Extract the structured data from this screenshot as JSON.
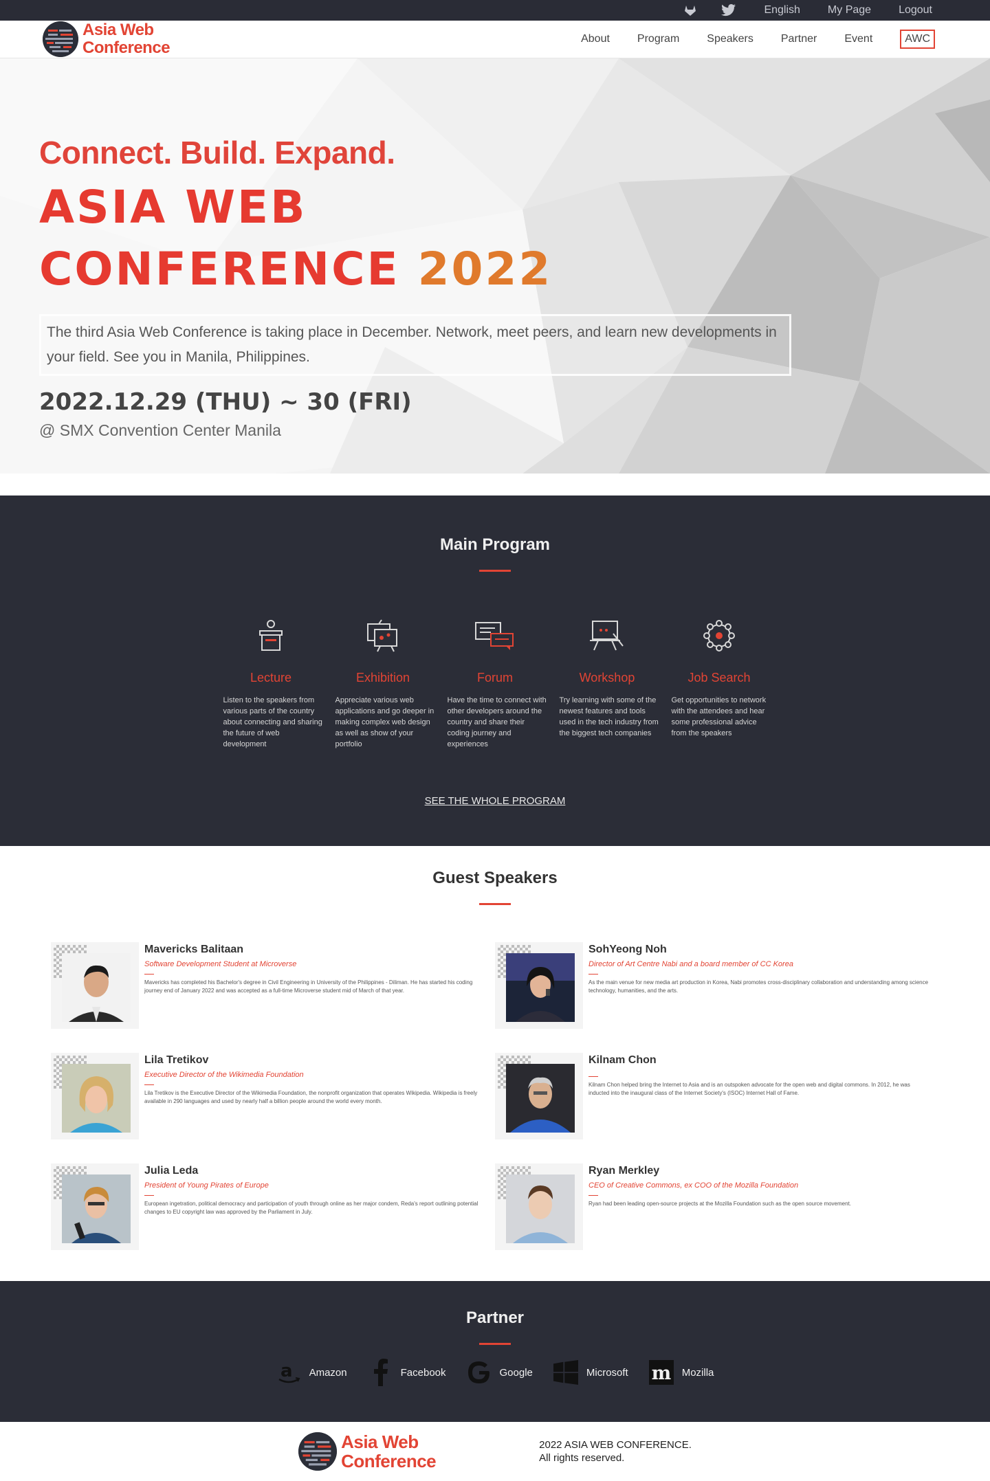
{
  "topbar": {
    "icons": [
      "gitlab-icon",
      "twitter-icon"
    ],
    "links": [
      "English",
      "My Page",
      "Logout"
    ]
  },
  "brand": {
    "line1": "Asia Web",
    "line2": "Conference",
    "color": "#e24434"
  },
  "nav": {
    "items": [
      "About",
      "Program",
      "Speakers",
      "Partner",
      "Event"
    ],
    "active": "AWC"
  },
  "hero": {
    "tagline": "Connect. Build. Expand.",
    "title_line1": "ASIA WEB",
    "title_line2": "CONFERENCE",
    "title_year": "2022",
    "description": "The third Asia Web Conference is taking place in December. Network, meet peers, and learn new developments in your field. See you in Manila, Philippines.",
    "date": "2022.12.29 (THU) ~ 30 (FRI)",
    "venue": "@ SMX Convention Center Manila"
  },
  "program": {
    "title": "Main Program",
    "items": [
      {
        "icon": "podium-icon",
        "title": "Lecture",
        "desc": "Listen to the speakers from various parts of the country about connecting and sharing the future of web development"
      },
      {
        "icon": "exhibition-icon",
        "title": "Exhibition",
        "desc": "Appreciate various web applications and go deeper in making complex web design as well as show of your portfolio"
      },
      {
        "icon": "chat-icon",
        "title": "Forum",
        "desc": "Have the time to connect with other developers around the country and share their coding journey and experiences"
      },
      {
        "icon": "presentation-icon",
        "title": "Workshop",
        "desc": "Try learning with some of the newest features and tools used in the tech industry from the biggest tech companies"
      },
      {
        "icon": "network-icon",
        "title": "Job Search",
        "desc": "Get opportunities to network with the attendees and hear some professional advice from the speakers"
      }
    ],
    "cta": "SEE THE WHOLE PROGRAM"
  },
  "speakers": {
    "title": "Guest Speakers",
    "list": [
      {
        "name": "Mavericks Balitaan",
        "role": "Software Development Student at Microverse",
        "bio": "Mavericks has completed his Bachelor's degree in Civil Engineering in University of the Philippines - Diliman. He has started his coding journey end of January 2022 and was accepted as a full-time Microverse student mid of March of that year."
      },
      {
        "name": "SohYeong Noh",
        "role": "Director of Art Centre Nabi and a board member of CC Korea",
        "bio": "As the main venue for new media art production in Korea, Nabi promotes cross-disciplinary collaboration and understanding among science technology, humanities, and the arts."
      },
      {
        "name": "Lila Tretikov",
        "role": "Executive Director of the Wikimedia Foundation",
        "bio": "Lila Tretikov is the Executive Director of the Wikimedia Foundation, the nonprofit organization that operates Wikipedia. Wikipedia is freely available in 290 languages and used by nearly half a billion people around the world every month."
      },
      {
        "name": "Kilnam Chon",
        "role": "",
        "bio": "Kilnam Chon helped bring the Internet to Asia and is an outspoken advocate for the open web and digital commons. In 2012, he was inducted into the inaugural class of the Internet Society's (ISOC) Internet Hall of Fame."
      },
      {
        "name": "Julia Leda",
        "role": "President of Young Pirates of Europe",
        "bio": "European ingetration, political democracy and participation of youth through online as her major condem, Reda's report outlining potential changes to EU copyright law was approved by the Parliament in July."
      },
      {
        "name": "Ryan Merkley",
        "role": "CEO of Creative Commons, ex COO of the Mozilla Foundation",
        "bio": "Ryan had been leading open-source projects at the Mozilla Foundation such as the open source movement."
      }
    ]
  },
  "partner": {
    "title": "Partner",
    "list": [
      {
        "icon": "amazon-icon",
        "name": "Amazon"
      },
      {
        "icon": "facebook-icon",
        "name": "Facebook"
      },
      {
        "icon": "google-icon",
        "name": "Google"
      },
      {
        "icon": "microsoft-icon",
        "name": "Microsoft"
      },
      {
        "icon": "mozilla-icon",
        "name": "Mozilla"
      }
    ]
  },
  "footer": {
    "line1": "2022 ASIA WEB CONFERENCE.",
    "line2": "All rights reserved."
  }
}
